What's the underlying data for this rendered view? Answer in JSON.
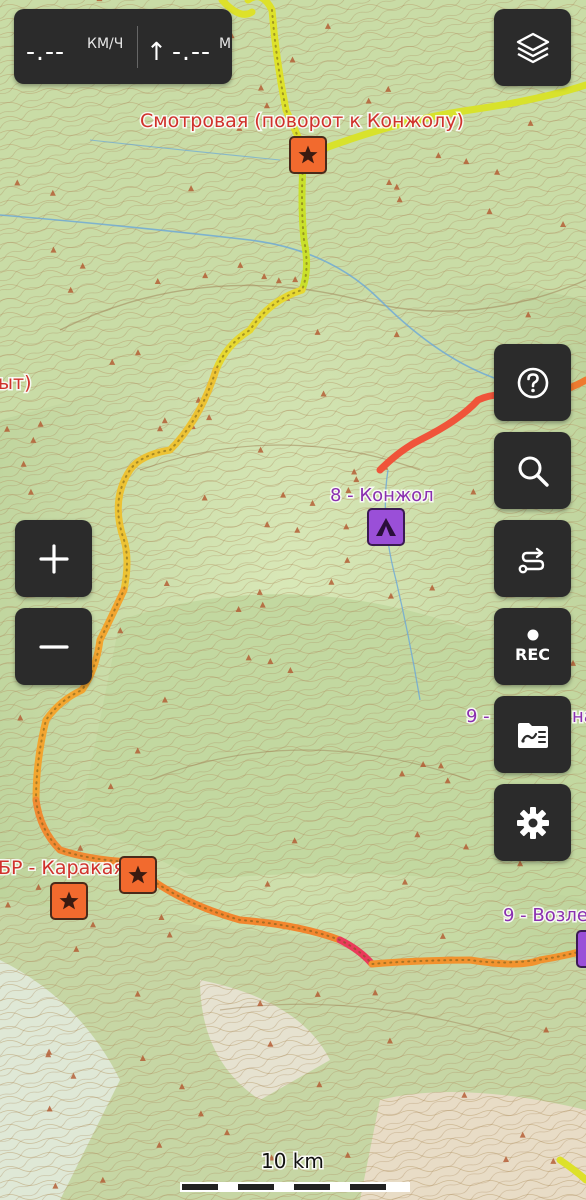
{
  "speed_panel": {
    "speed_value": "-.--",
    "speed_unit": "КМ/Ч",
    "arrow": "↑",
    "altitude_value": "-.--",
    "altitude_unit": "М"
  },
  "controls": {
    "layers": "layers-icon",
    "zoom_in": "+",
    "zoom_out": "−",
    "help": "help-icon",
    "search": "search-icon",
    "route": "route-icon",
    "rec_label": "REC",
    "tracks": "folder-icon",
    "settings": "gear-icon"
  },
  "map_labels": {
    "viewpoint": "Смотровая (поворот к Конжолу)",
    "partial_left": "ыт)",
    "camp_konzhol": "8 - Конжол",
    "partial_right_9a": "9 -",
    "partial_right_9a_tail": "на",
    "karakaya": "БР - Каракая-су",
    "partial_right_9b": "9 - Возле"
  },
  "scale": {
    "label": "10 km"
  },
  "colors": {
    "map_base": "#cfe0b0",
    "panel": "#2b2b2b",
    "track_yellow": "#dde12a",
    "track_orange": "#f29a2e",
    "track_red": "#ec4a3a",
    "track_magenta": "#e0338a",
    "marker_star": "#f26a2e",
    "marker_camp": "#9a4fd8"
  }
}
